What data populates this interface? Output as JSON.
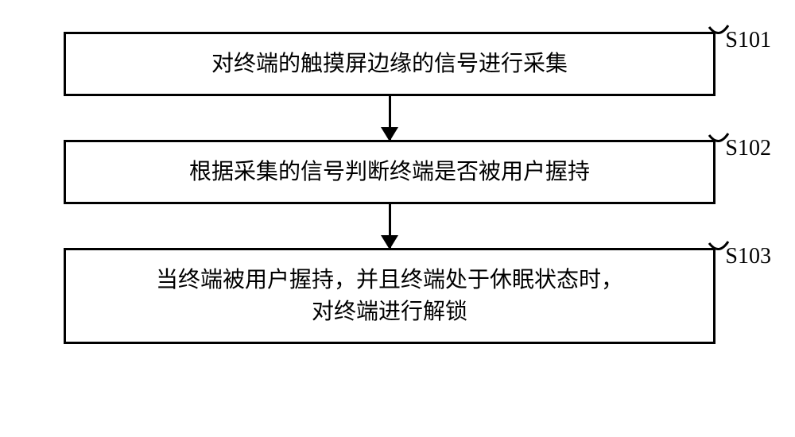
{
  "chart_data": {
    "type": "flowchart",
    "direction": "top-to-bottom",
    "nodes": [
      {
        "id": "S101",
        "label": "对终端的触摸屏边缘的信号进行采集",
        "tag": "S101"
      },
      {
        "id": "S102",
        "label": "根据采集的信号判断终端是否被用户握持",
        "tag": "S102"
      },
      {
        "id": "S103",
        "label": "当终端被用户握持，并且终端处于休眠状态时，\n对终端进行解锁",
        "tag": "S103"
      }
    ],
    "edges": [
      {
        "from": "S101",
        "to": "S102"
      },
      {
        "from": "S102",
        "to": "S103"
      }
    ]
  },
  "steps": {
    "s1": {
      "text": "对终端的触摸屏边缘的信号进行采集",
      "tag": "S101"
    },
    "s2": {
      "text": "根据采集的信号判断终端是否被用户握持",
      "tag": "S102"
    },
    "s3": {
      "line1": "当终端被用户握持，并且终端处于休眠状态时，",
      "line2": "对终端进行解锁",
      "tag": "S103"
    }
  }
}
